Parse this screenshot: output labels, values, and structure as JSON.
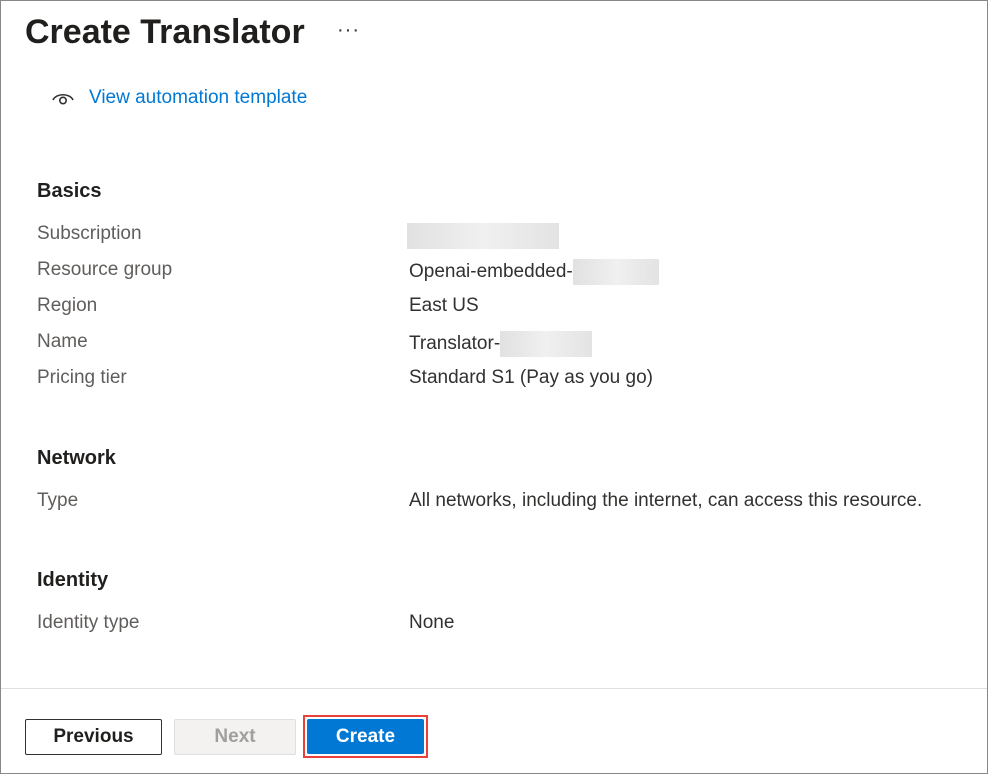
{
  "header": {
    "title": "Create Translator",
    "more_label": "···"
  },
  "template_link": {
    "icon": "eye-icon",
    "label": "View automation template"
  },
  "sections": {
    "basics": {
      "heading": "Basics",
      "rows": [
        {
          "label": "Subscription",
          "value": "",
          "redacted": true
        },
        {
          "label": "Resource group",
          "value": "Openai-embedded-",
          "redacted": true
        },
        {
          "label": "Region",
          "value": "East US"
        },
        {
          "label": "Name",
          "value": "Translator-",
          "redacted": true
        },
        {
          "label": "Pricing tier",
          "value": "Standard S1 (Pay as you go)"
        }
      ]
    },
    "network": {
      "heading": "Network",
      "rows": [
        {
          "label": "Type",
          "value": "All networks, including the internet, can access this resource."
        }
      ]
    },
    "identity": {
      "heading": "Identity",
      "rows": [
        {
          "label": "Identity type",
          "value": "None"
        }
      ]
    }
  },
  "footer": {
    "previous_label": "Previous",
    "next_label": "Next",
    "create_label": "Create"
  },
  "colors": {
    "accent": "#0078d4",
    "highlight": "#e8413c"
  }
}
